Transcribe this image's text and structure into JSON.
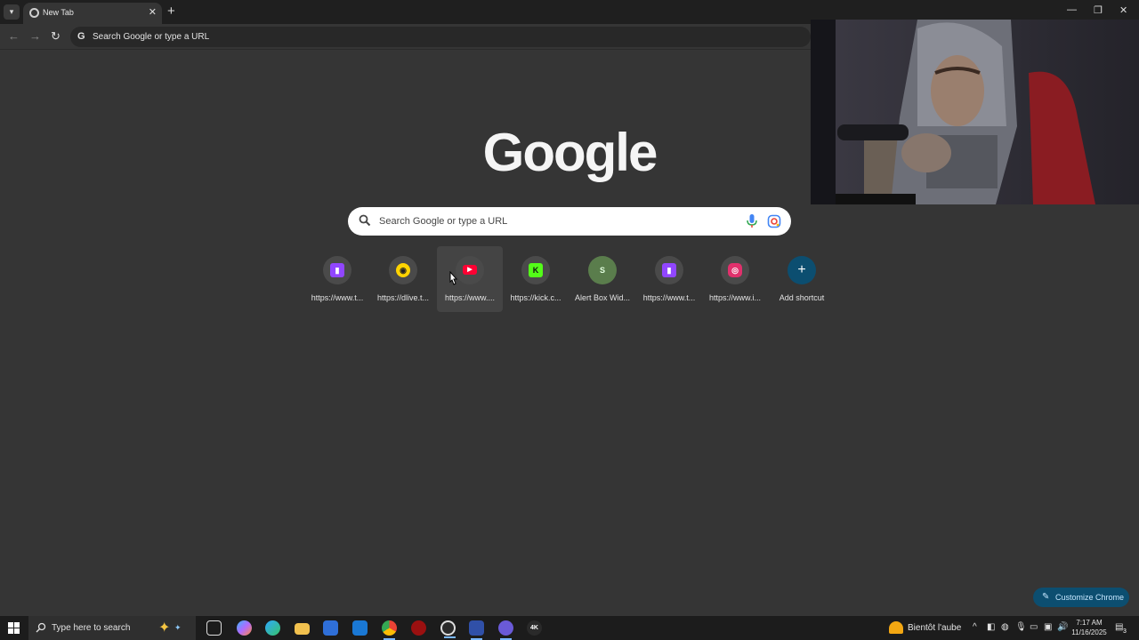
{
  "browser": {
    "tab_title": "New Tab",
    "omnibox_text": "Search Google or type a URL"
  },
  "page": {
    "logo_text": "Google",
    "search_placeholder": "Search Google or type a URL",
    "shortcuts": [
      {
        "label": "https://www.t...",
        "icon": "twitch-icon",
        "color": "#9146ff"
      },
      {
        "label": "https://dlive.t...",
        "icon": "dlive-icon",
        "color": "#ffd300"
      },
      {
        "label": "https://www....",
        "icon": "youtube-icon",
        "color": "#ff0033"
      },
      {
        "label": "https://kick.c...",
        "icon": "kick-icon",
        "color": "#53fc18"
      },
      {
        "label": "Alert Box Wid...",
        "icon": "streamlabs-icon",
        "color": "#80f5d2"
      },
      {
        "label": "https://www.t...",
        "icon": "twitch-icon",
        "color": "#9146ff"
      },
      {
        "label": "https://www.i...",
        "icon": "instagram-icon",
        "color": "#e1306c"
      },
      {
        "label": "Add shortcut",
        "icon": "plus-icon",
        "color": "#0c4e70"
      }
    ],
    "customize_label": "Customize Chrome"
  },
  "taskbar": {
    "search_placeholder": "Type here to search",
    "weather": "Bientôt l'aube",
    "time": "7:17 AM",
    "date": "11/16/2025",
    "notification_count": "3"
  },
  "colors": {
    "background": "#353535",
    "accent": "#0c4e70"
  }
}
